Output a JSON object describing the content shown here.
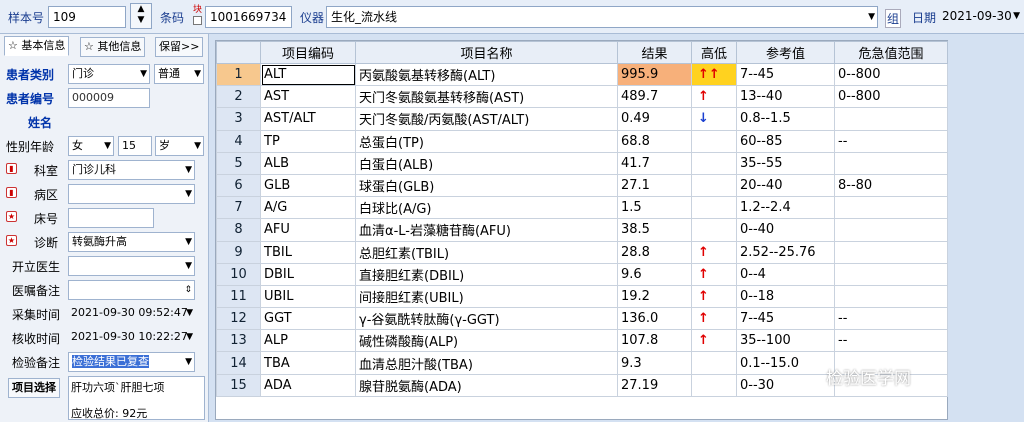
{
  "header": {
    "sample_no_label": "样本号",
    "sample_no": "109",
    "barcode_label": "条码",
    "barcode_tag": "块",
    "barcode": "1001669734",
    "instrument_label": "仪器",
    "instrument": "生化_流水线",
    "group_label": "组",
    "date_label": "日期",
    "date": "2021-09-30"
  },
  "left": {
    "tab_basic": "☆ 基本信息",
    "tab_other": "☆ 其他信息",
    "tab_save": "保留>>",
    "patient_type_label": "患者类别",
    "patient_type": "门诊",
    "patient_type2": "普通",
    "patient_no_label": "患者编号",
    "patient_no": "000009",
    "name_label": "姓名",
    "sex_age_label": "性别年龄",
    "sex": "女",
    "age": "15",
    "age_unit": "岁",
    "dept_label": "科室",
    "dept": "门诊儿科",
    "ward_label": "病区",
    "bed_label": "床号",
    "diagnosis_label": "诊断",
    "diagnosis": "转氨酶升高",
    "doctor_label": "开立医生",
    "order_note_label": "医嘱备注",
    "collect_label": "采集时间",
    "collect_time": "2021-09-30 09:52:47",
    "receive_label": "核收时间",
    "receive_time": "2021-09-30 10:22:27",
    "test_note_label": "检验备注",
    "test_note": "检验结果已复查",
    "item_select_label": "项目选择",
    "item_select": "肝功六项`肝胆七项",
    "total_price": "应收总价: 92元"
  },
  "table": {
    "headers": [
      "",
      "项目编码",
      "项目名称",
      "结果",
      "高低",
      "参考值",
      "危急值范围"
    ],
    "rows": [
      [
        "1",
        "ALT",
        "丙氨酸氨基转移酶(ALT)",
        "995.9",
        "↑↑",
        "7--45",
        "0--800"
      ],
      [
        "2",
        "AST",
        "天门冬氨酸氨基转移酶(AST)",
        "489.7",
        "↑",
        "13--40",
        "0--800"
      ],
      [
        "3",
        "AST/ALT",
        "天门冬氨酸/丙氨酸(AST/ALT)",
        "0.49",
        "↓",
        "0.8--1.5",
        ""
      ],
      [
        "4",
        "TP",
        "总蛋白(TP)",
        "68.8",
        "",
        "60--85",
        "--"
      ],
      [
        "5",
        "ALB",
        "白蛋白(ALB)",
        "41.7",
        "",
        "35--55",
        ""
      ],
      [
        "6",
        "GLB",
        "球蛋白(GLB)",
        "27.1",
        "",
        "20--40",
        "8--80"
      ],
      [
        "7",
        "A/G",
        "白球比(A/G)",
        "1.5",
        "",
        "1.2--2.4",
        ""
      ],
      [
        "8",
        "AFU",
        "血清α-L-岩藻糖苷酶(AFU)",
        "38.5",
        "",
        "0--40",
        ""
      ],
      [
        "9",
        "TBIL",
        "总胆红素(TBIL)",
        "28.8",
        "↑",
        "2.52--25.76",
        ""
      ],
      [
        "10",
        "DBIL",
        "直接胆红素(DBIL)",
        "9.6",
        "↑",
        "0--4",
        ""
      ],
      [
        "11",
        "UBIL",
        "间接胆红素(UBIL)",
        "19.2",
        "↑",
        "0--18",
        ""
      ],
      [
        "12",
        "GGT",
        "γ-谷氨酰转肽酶(γ-GGT)",
        "136.0",
        "↑",
        "7--45",
        "--"
      ],
      [
        "13",
        "ALP",
        "碱性磷酸酶(ALP)",
        "107.8",
        "↑",
        "35--100",
        "--"
      ],
      [
        "14",
        "TBA",
        "血清总胆汁酸(TBA)",
        "9.3",
        "",
        "0.1--15.0",
        ""
      ],
      [
        "15",
        "ADA",
        "腺苷脱氨酶(ADA)",
        "27.19",
        "",
        "0--30",
        ""
      ]
    ]
  },
  "watermark": "检验医学网"
}
